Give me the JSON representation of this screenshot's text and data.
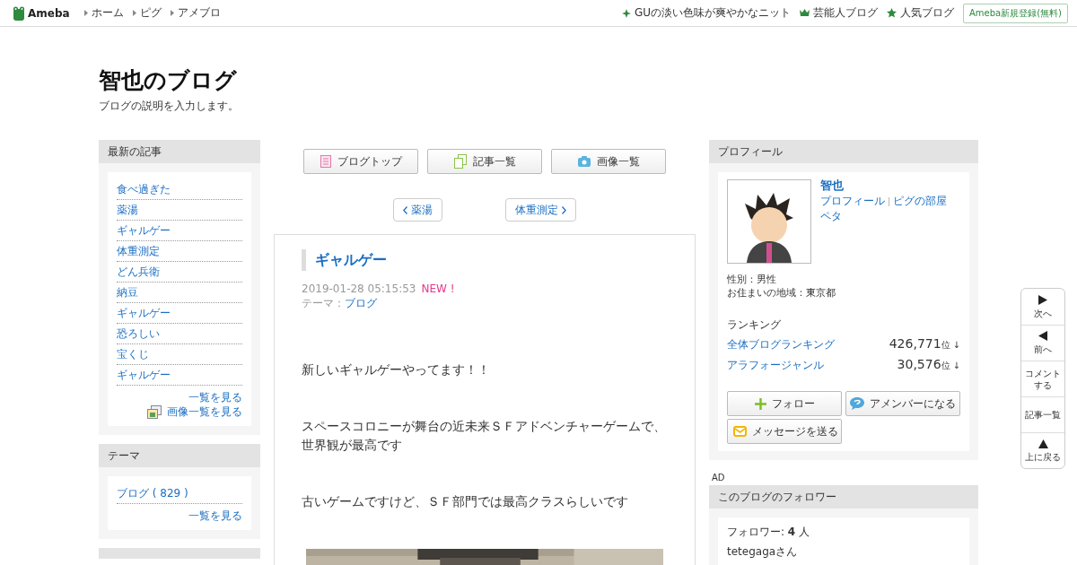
{
  "header": {
    "logo": "Ameba",
    "nav": [
      "ホーム",
      "ピグ",
      "アメブロ"
    ],
    "right_links": [
      {
        "label": "GUの淡い色味が爽やかなニット"
      },
      {
        "label": "芸能人ブログ"
      },
      {
        "label": "人気ブログ"
      }
    ],
    "signup": "Ameba新規登録(無料)"
  },
  "blog": {
    "title": "智也のブログ",
    "description": "ブログの説明を入力します。"
  },
  "recent": {
    "title": "最新の記事",
    "items": [
      "食べ過ぎた",
      "薬湯",
      "ギャルゲー",
      "体重測定",
      "どん兵衛",
      "納豆",
      "ギャルゲー",
      "恐ろしい",
      "宝くじ",
      "ギャルゲー"
    ],
    "more": "一覧を見る",
    "image_more": "画像一覧を見る"
  },
  "theme": {
    "title": "テーマ",
    "items": [
      "ブログ ( 829 )"
    ],
    "more": "一覧を見る"
  },
  "main": {
    "top_buttons": [
      {
        "label": "ブログトップ"
      },
      {
        "label": "記事一覧"
      },
      {
        "label": "画像一覧"
      }
    ],
    "prev": "薬湯",
    "next": "体重測定",
    "article": {
      "title": "ギャルゲー",
      "date": "2019-01-28 05:15:53",
      "badge": "NEW !",
      "theme_label": "テーマ：",
      "theme": "ブログ",
      "paragraphs": [
        "新しいギャルゲーやってます！！",
        "スペースコロニーが舞台の近未来ＳＦアドベンチャーゲームで、世界観が最高です",
        "古いゲームですけど、ＳＦ部門では最高クラスらしいです"
      ]
    }
  },
  "profile": {
    "title": "プロフィール",
    "name": "智也",
    "links": [
      "プロフィール",
      "ピグの部屋"
    ],
    "peta": "ペタ",
    "details": [
      "性別：男性",
      "お住まいの地域：東京都"
    ],
    "ranking_title": "ランキング",
    "rankings": [
      {
        "label": "全体ブログランキング",
        "rank": "426,771",
        "unit": "位",
        "arrow": "↓"
      },
      {
        "label": "アラフォージャンル",
        "rank": "30,576",
        "unit": "位",
        "arrow": "↓"
      }
    ],
    "buttons": [
      {
        "label": "フォロー"
      },
      {
        "label": "アメンバーになる"
      },
      {
        "label": "メッセージを送る"
      }
    ]
  },
  "ad": "AD",
  "followers": {
    "title": "このブログのフォロワー",
    "count_label": "フォロワー: ",
    "count": "4",
    "count_unit": " 人",
    "names": [
      "tetegagaさん"
    ]
  },
  "side_nav": [
    {
      "label": "次へ"
    },
    {
      "label": "前へ"
    },
    {
      "label": "コメントする"
    },
    {
      "label": "記事一覧"
    },
    {
      "label": "上に戻る"
    }
  ]
}
